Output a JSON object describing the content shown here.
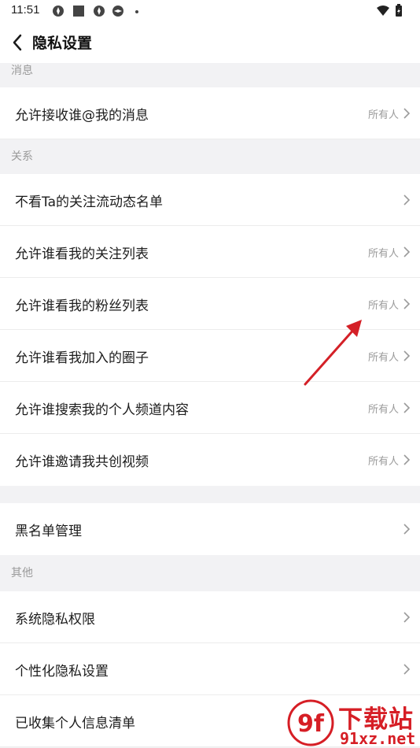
{
  "status_bar": {
    "time": "11:51"
  },
  "header": {
    "title": "隐私设置"
  },
  "sections": [
    {
      "header": "消息"
    },
    {
      "header": "关系"
    },
    {
      "header": ""
    },
    {
      "header": "其他"
    }
  ],
  "rows": {
    "allow_mention": {
      "label": "允许接收谁@我的消息",
      "value": "所有人"
    },
    "hide_feed": {
      "label": "不看Ta的关注流动态名单"
    },
    "following_list": {
      "label": "允许谁看我的关注列表",
      "value": "所有人"
    },
    "fans_list": {
      "label": "允许谁看我的粉丝列表",
      "value": "所有人"
    },
    "joined_circles": {
      "label": "允许谁看我加入的圈子",
      "value": "所有人"
    },
    "search_channel": {
      "label": "允许谁搜索我的个人频道内容",
      "value": "所有人"
    },
    "cocreate_invite": {
      "label": "允许谁邀请我共创视频",
      "value": "所有人"
    },
    "blacklist": {
      "label": "黑名单管理"
    },
    "system_permissions": {
      "label": "系统隐私权限"
    },
    "personalized_privacy": {
      "label": "个性化隐私设置"
    },
    "collected_info": {
      "label": "已收集个人信息清单"
    }
  },
  "watermark": {
    "title": "下载站",
    "url": "91xz.net",
    "logo_text": "9f"
  },
  "colors": {
    "annotation_arrow": "#d42027",
    "watermark": "#d61e25",
    "background": "#f2f2f4"
  }
}
